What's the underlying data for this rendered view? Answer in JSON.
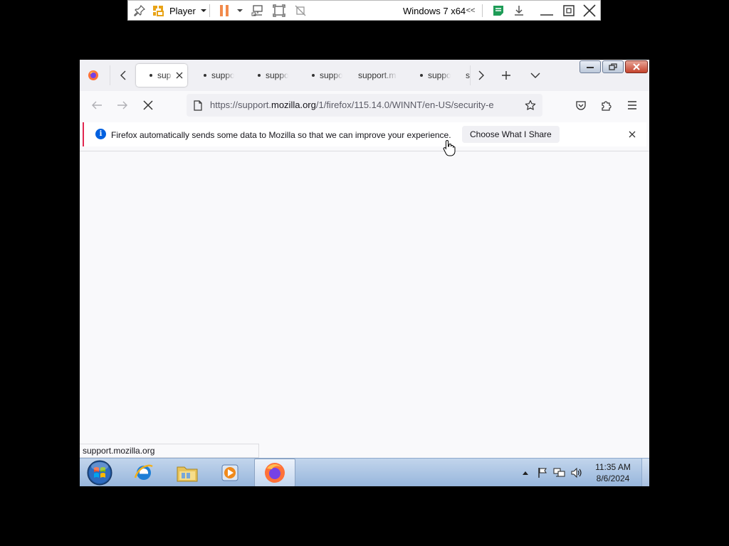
{
  "vmware": {
    "player_label": "Player",
    "vm_name": "Windows 7 x64",
    "collapse_label": "<<"
  },
  "browser": {
    "tabs": [
      {
        "label": "sup",
        "active": true
      },
      {
        "label": "suppo",
        "active": false
      },
      {
        "label": "suppo",
        "active": false
      },
      {
        "label": "suppo",
        "active": false
      },
      {
        "label": "support.m",
        "active": false
      },
      {
        "label": "suppo",
        "active": false
      },
      {
        "label": "s",
        "active": false
      }
    ],
    "url_prefix": "https://support.",
    "url_domain": "mozilla.org",
    "url_rest": "/1/firefox/115.14.0/WINNT/en-US/security-e",
    "notification_text": "Firefox automatically sends some data to Mozilla so that we can improve your experience.",
    "notification_button": "Choose What I Share",
    "status_text": "support.mozilla.org",
    "accent_color": "#e22850",
    "info_color": "#0060df"
  },
  "taskbar": {
    "apps": [
      "windows-start-orb",
      "internet-explorer",
      "windows-explorer",
      "media-player",
      "firefox"
    ],
    "active_app": "firefox",
    "time": "11:35 AM",
    "date": "8/6/2024"
  }
}
